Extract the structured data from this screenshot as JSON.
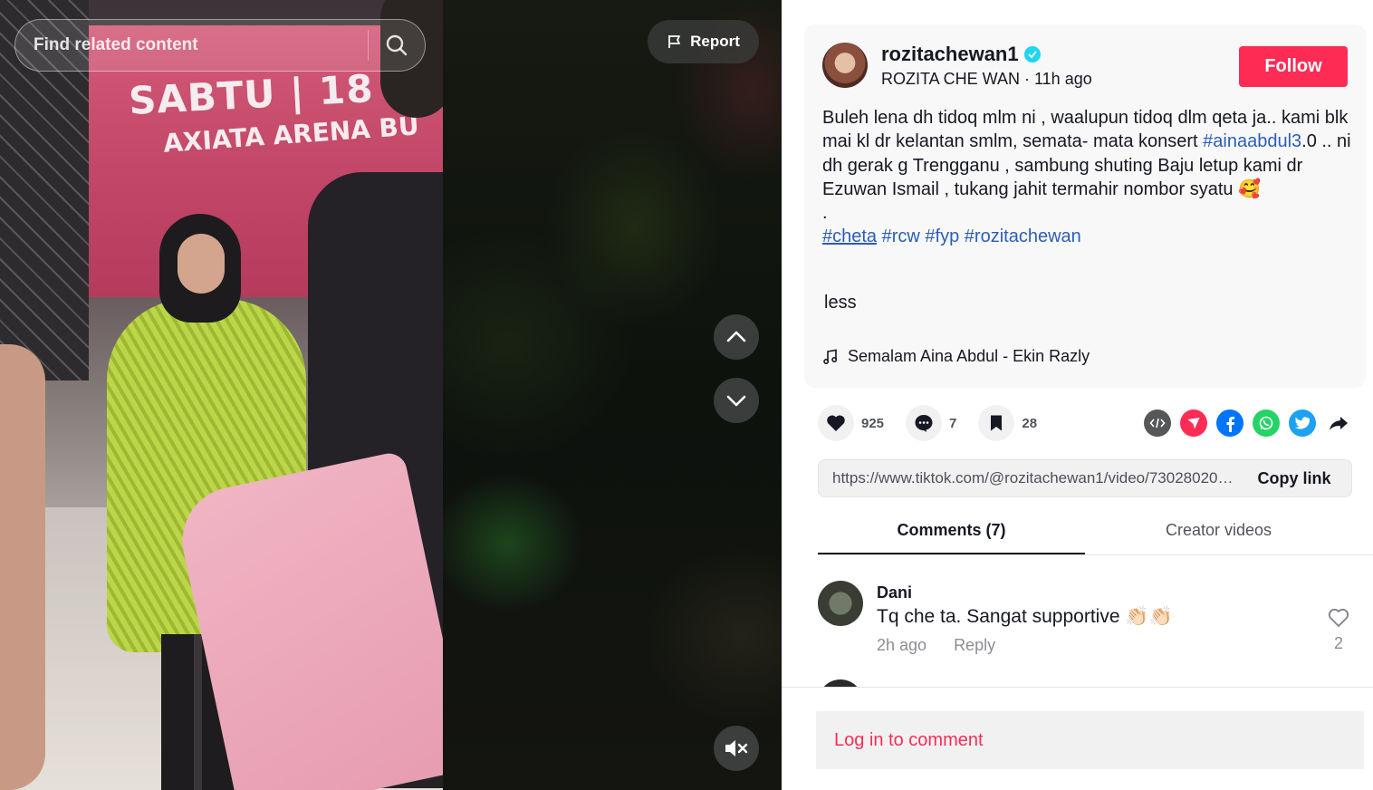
{
  "search": {
    "placeholder": "Find related content"
  },
  "video": {
    "banner_line1": "SABTU | 18",
    "banner_line2": "AXIATA ARENA BU",
    "report_label": "Report"
  },
  "author": {
    "username": "rozitachewan1",
    "display_name": "ROZITA CHE WAN",
    "separator": " · ",
    "posted": "11h ago",
    "follow_label": "Follow"
  },
  "description": {
    "line1": "Buleh lena dh tidoq mlm ni , waalupun tidoq dlm qeta ja.. kami blk mai kl dr kelantan smlm, semata- mata konsert ",
    "hashtag_main": "#ainaabdul3",
    "line2": ".0 .. ni dh gerak g Trengganu , sambung shuting Baju letup kami dr Ezuwan Ismail , tukang jahit termahir nombor syatu 🥰",
    "dot": ".",
    "tags": [
      "#cheta",
      "#rcw",
      "#fyp",
      "#rozitachewan"
    ],
    "less_label": "less",
    "music": "Semalam Aina Abdul - Ekin Razly"
  },
  "actions": {
    "likes": "925",
    "comments": "7",
    "saves": "28"
  },
  "share": {
    "icons": [
      "embed-icon",
      "send-to-friends-icon",
      "facebook-icon",
      "whatsapp-icon",
      "twitter-icon",
      "share-arrow-icon"
    ],
    "colors": {
      "embed": "#565758",
      "send": "#fe2c55",
      "facebook": "#0075fa",
      "whatsapp": "#25d366",
      "twitter": "#1da1f2"
    }
  },
  "link": {
    "url": "https://www.tiktok.com/@rozitachewan1/video/7302802000000000000",
    "copy_label": "Copy link"
  },
  "tabs": [
    {
      "label": "Comments (7)",
      "active": true
    },
    {
      "label": "Creator videos",
      "active": false
    }
  ],
  "comments": [
    {
      "name": "Dani",
      "text": "Tq che ta. Sangat supportive 👏🏻👏🏻",
      "time": "2h ago",
      "reply_label": "Reply",
      "likes": "2"
    }
  ],
  "footer": {
    "login_label": "Log in to comment"
  },
  "colors": {
    "accent": "#fe2c55",
    "hashtag": "#2b5db9",
    "verified": "#20d5ec"
  }
}
